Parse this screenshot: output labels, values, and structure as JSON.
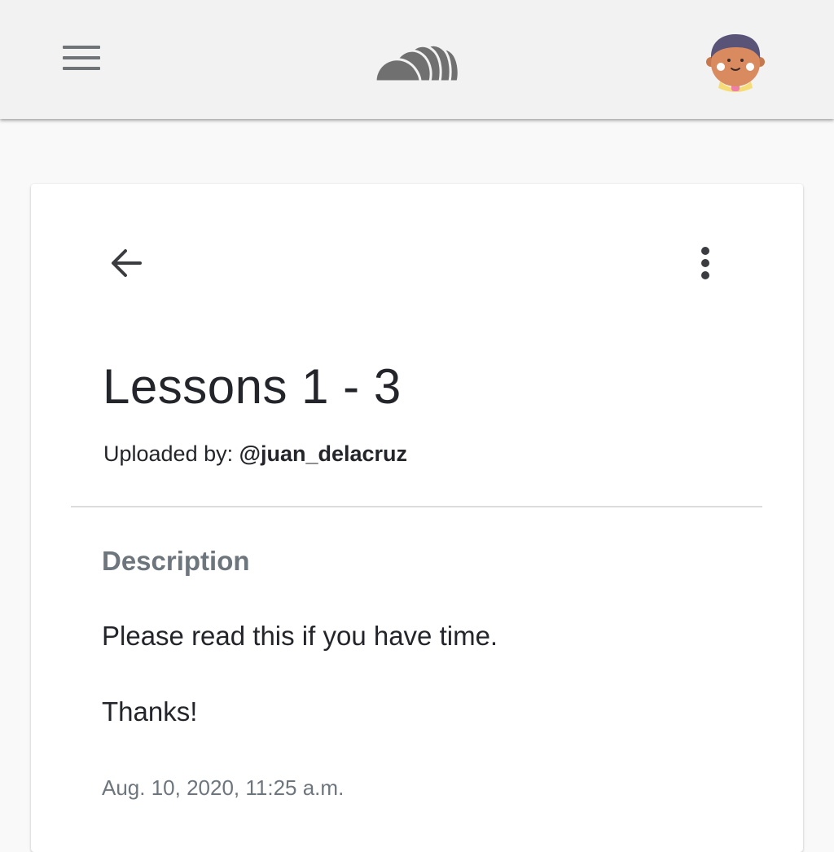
{
  "appbar": {
    "menu_icon": "hamburger-menu-icon",
    "logo_icon": "cloud-logo-icon",
    "avatar_icon": "user-avatar-icon"
  },
  "card": {
    "back_icon": "arrow-back-icon",
    "more_icon": "more-vertical-icon",
    "title": "Lessons 1 - 3",
    "uploaded_label": "Uploaded by: ",
    "uploader": "@juan_delacruz",
    "description_heading": "Description",
    "description_lines": [
      "Please read this if you have time.",
      "Thanks!"
    ],
    "timestamp": "Aug. 10, 2020, 11:25 a.m."
  },
  "colors": {
    "appbar_bg": "#f2f2f2",
    "page_bg": "#f9f9f9",
    "card_bg": "#ffffff",
    "icon_gray": "#6f7378",
    "text_primary": "#23252a",
    "text_secondary": "#6d757d"
  }
}
